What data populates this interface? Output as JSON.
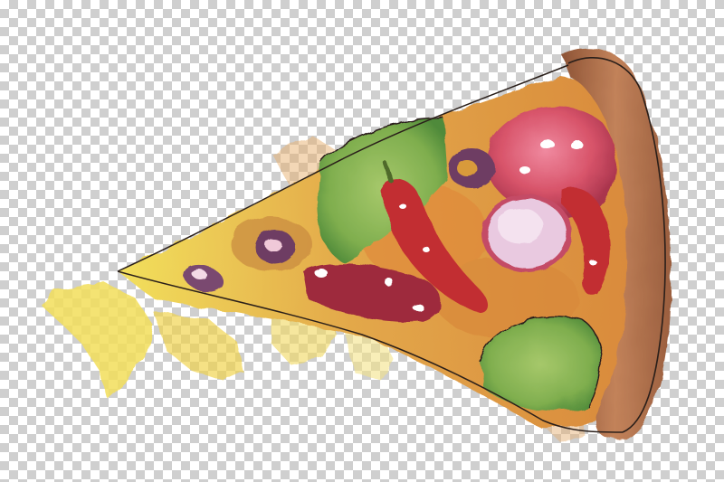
{
  "image": {
    "background": "transparency-checkerboard",
    "subject": "watercolor-pizza-slice",
    "colors": {
      "checker_light": "#ffffff",
      "checker_dark": "#cfcfcf",
      "crust": "#b5734a",
      "crust_shadow": "#8e5436",
      "cheese": "#e8b64a",
      "cheese_drip": "#f3de5a",
      "sauce": "#d9893a",
      "salami": "#d8546a",
      "pepperoni_ring": "#c44c66",
      "pepper": "#c22d33",
      "olive": "#6e3e64",
      "green_pepper": "#7fae4e",
      "onion": "#e9c9e0",
      "outline": "#2a1f1a"
    }
  }
}
